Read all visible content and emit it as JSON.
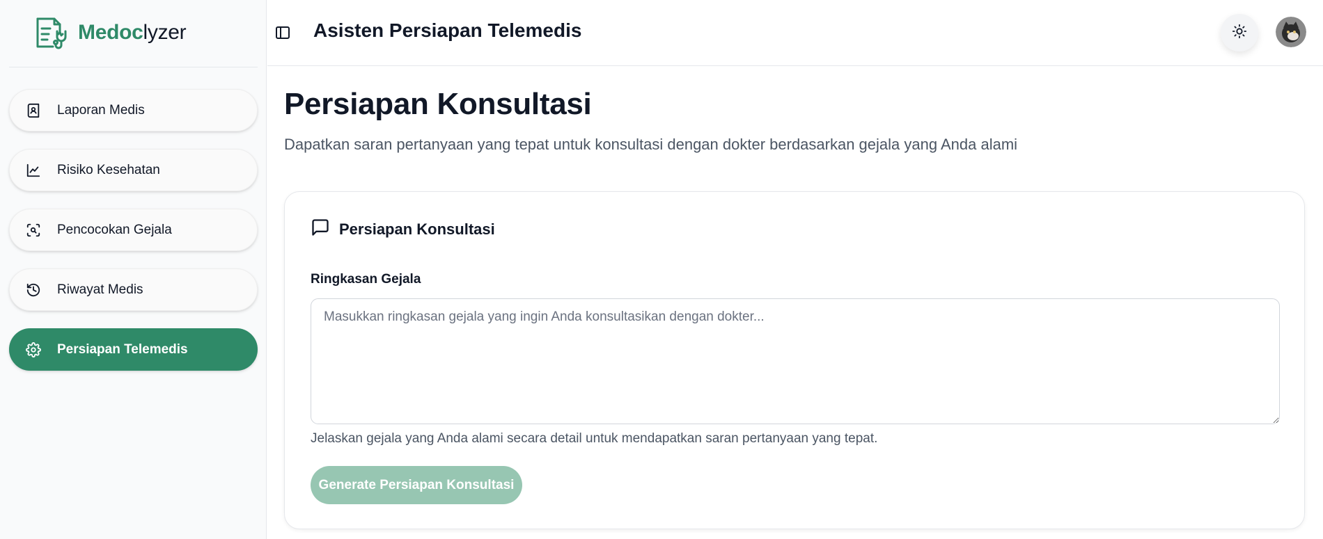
{
  "brand": {
    "name_accent": "Medoc",
    "name_rest": "lyzer",
    "logo_icon": "medical-report-stethoscope-icon"
  },
  "colors": {
    "brand_green": "#2f8a68",
    "button_disabled": "#97c6b2"
  },
  "sidebar": {
    "items": [
      {
        "label": "Laporan Medis",
        "icon": "report-icon",
        "active": false
      },
      {
        "label": "Risiko Kesehatan",
        "icon": "line-chart-icon",
        "active": false
      },
      {
        "label": "Pencocokan Gejala",
        "icon": "scan-search-icon",
        "active": false
      },
      {
        "label": "Riwayat Medis",
        "icon": "history-icon",
        "active": false
      },
      {
        "label": "Persiapan Telemedis",
        "icon": "gear-icon",
        "active": true
      }
    ]
  },
  "header": {
    "title": "Asisten Persiapan Telemedis",
    "toggle_icon": "sidebar-toggle-icon",
    "theme_icon": "sun-icon"
  },
  "main": {
    "title": "Persiapan Konsultasi",
    "subtitle": "Dapatkan saran pertanyaan yang tepat untuk konsultasi dengan dokter berdasarkan gejala yang Anda alami"
  },
  "card": {
    "title": "Persiapan Konsultasi",
    "icon": "message-square-icon",
    "field_label": "Ringkasan Gejala",
    "placeholder": "Masukkan ringkasan gejala yang ingin Anda konsultasikan dengan dokter...",
    "value": "",
    "helper": "Jelaskan gejala yang Anda alami secara detail untuk mendapatkan saran pertanyaan yang tepat.",
    "button_label": "Generate Persiapan Konsultasi"
  }
}
